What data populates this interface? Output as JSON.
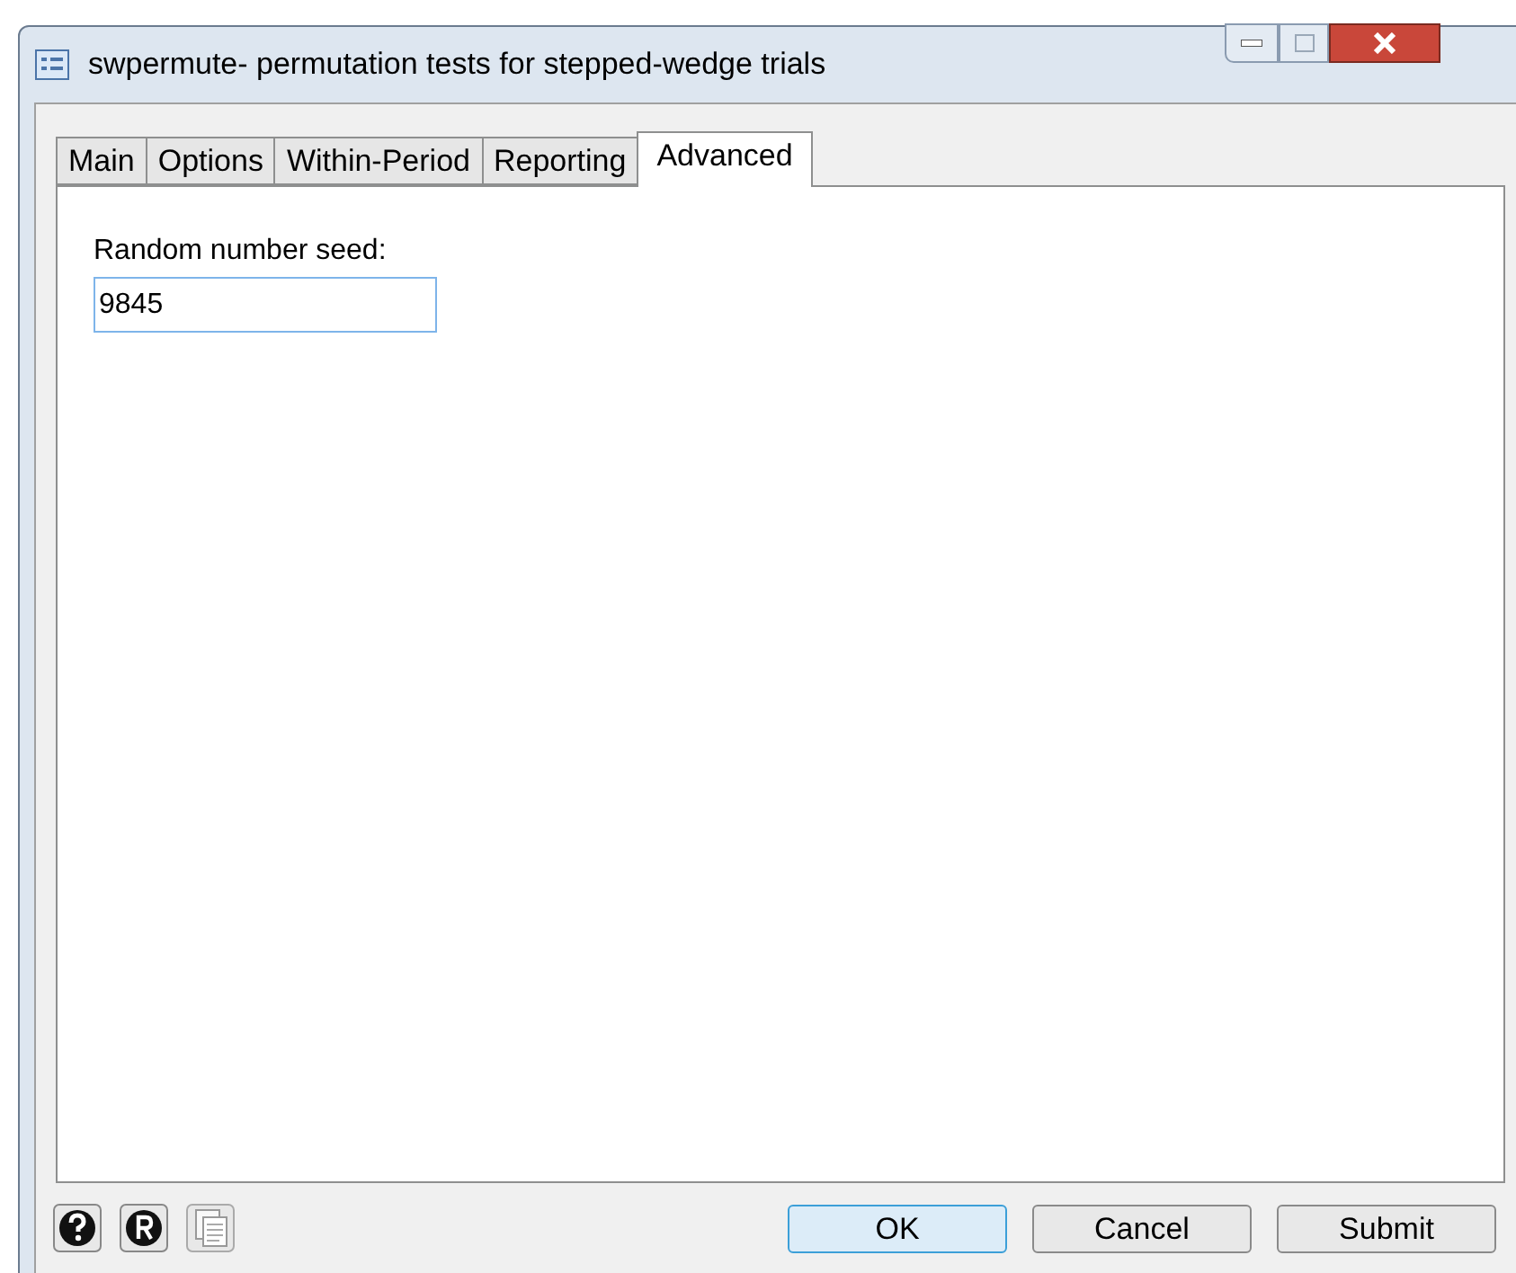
{
  "window": {
    "title": "swpermute- permutation tests for stepped-wedge trials"
  },
  "tabs": [
    {
      "label": "Main",
      "selected": false
    },
    {
      "label": "Options",
      "selected": false
    },
    {
      "label": "Within-Period",
      "selected": false
    },
    {
      "label": "Reporting",
      "selected": false
    },
    {
      "label": "Advanced",
      "selected": true
    }
  ],
  "seed": {
    "label": "Random number seed:",
    "value": "9845"
  },
  "buttons": [
    {
      "label": "OK",
      "default": true
    },
    {
      "label": "Cancel",
      "default": false
    },
    {
      "label": "Submit",
      "default": false
    }
  ]
}
